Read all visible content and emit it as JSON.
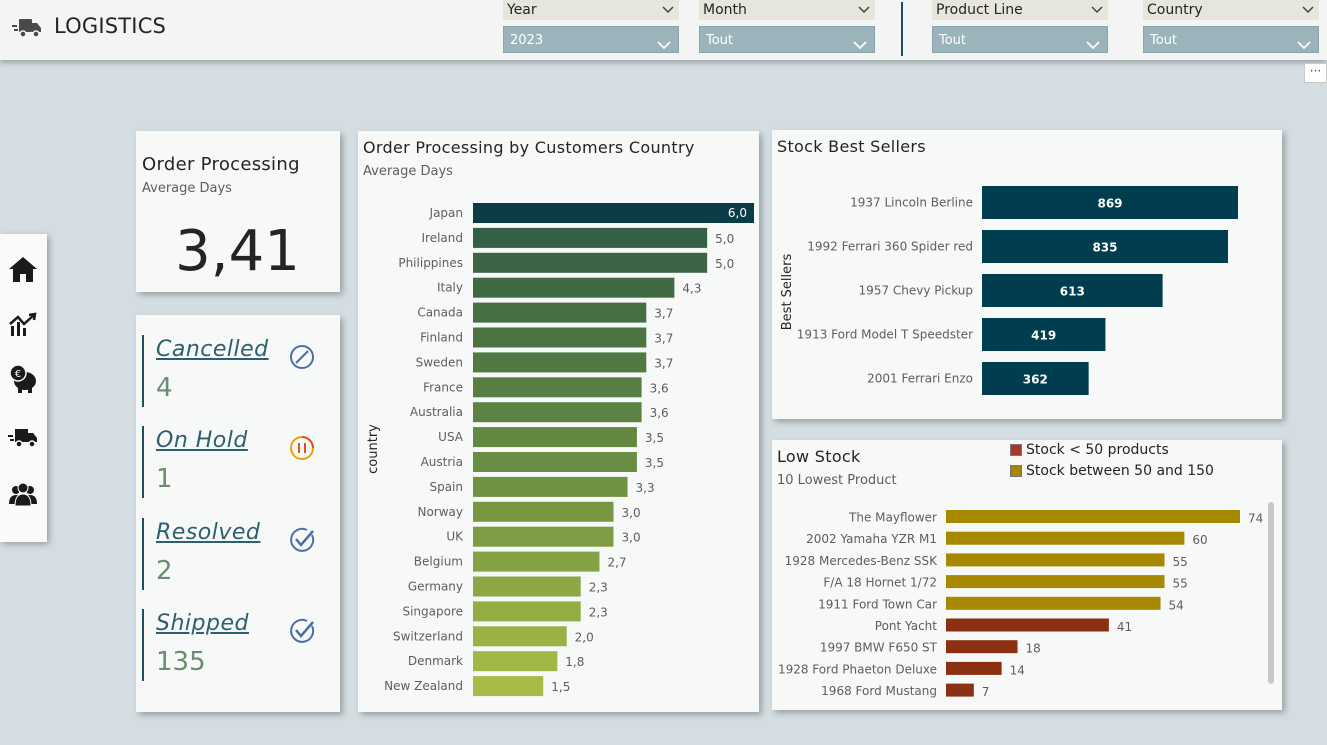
{
  "header": {
    "title": "LOGISTICS",
    "icon": "truck-icon"
  },
  "slicers": [
    {
      "label": "Year",
      "value": "2023"
    },
    {
      "label": "Month",
      "value": "Tout"
    },
    {
      "label": "Product Line",
      "value": "Tout"
    },
    {
      "label": "Country",
      "value": "Tout"
    }
  ],
  "more_button": "···",
  "nav": [
    "home-icon",
    "sales-chart-icon",
    "piggy-bank-icon",
    "truck-icon",
    "customers-icon"
  ],
  "kpi": {
    "title": "Order Processing",
    "subtitle": "Average Days",
    "value": "3,41"
  },
  "statuses": [
    {
      "label": "Cancelled",
      "count": "4",
      "icon": "cancel-icon"
    },
    {
      "label": "On Hold",
      "count": "1",
      "icon": "pause-icon"
    },
    {
      "label": "Resolved",
      "count": "2",
      "icon": "check-icon"
    },
    {
      "label": "Shipped",
      "count": "135",
      "icon": "check-icon"
    }
  ],
  "colors": {
    "dark_teal": "#003e4f",
    "low_stock_red": "#8b3010",
    "mid_stock_gold": "#a68900"
  },
  "chart_data": [
    {
      "type": "bar",
      "orientation": "horizontal",
      "title": "Order Processing by Customers Country",
      "subtitle": "Average Days",
      "ylabel": "country",
      "categories": [
        "Japan",
        "Ireland",
        "Philippines",
        "Italy",
        "Canada",
        "Finland",
        "Sweden",
        "France",
        "Australia",
        "USA",
        "Austria",
        "Spain",
        "Norway",
        "UK",
        "Belgium",
        "Germany",
        "Singapore",
        "Switzerland",
        "Denmark",
        "New Zealand"
      ],
      "values": [
        6.0,
        5.0,
        5.0,
        4.3,
        3.7,
        3.7,
        3.7,
        3.6,
        3.6,
        3.5,
        3.5,
        3.3,
        3.0,
        3.0,
        2.7,
        2.3,
        2.3,
        2.0,
        1.8,
        1.5
      ],
      "value_labels": [
        "6,0",
        "5,0",
        "5,0",
        "4,3",
        "3,7",
        "3,7",
        "3,7",
        "3,6",
        "3,6",
        "3,5",
        "3,5",
        "3,3",
        "3,0",
        "3,0",
        "2,7",
        "2,3",
        "2,3",
        "2,0",
        "1,8",
        "1,5"
      ],
      "xlim": [
        0,
        6
      ]
    },
    {
      "type": "bar",
      "orientation": "horizontal",
      "title": "Stock Best Sellers",
      "ylabel": "Best Sellers",
      "categories": [
        "1937 Lincoln Berline",
        "1992 Ferrari 360 Spider red",
        "1957 Chevy Pickup",
        "1913 Ford Model T Speedster",
        "2001 Ferrari Enzo"
      ],
      "values": [
        869,
        835,
        613,
        419,
        362
      ],
      "value_labels": [
        "869",
        "835",
        "613",
        "419",
        "362"
      ],
      "xlim": [
        0,
        869
      ]
    },
    {
      "type": "bar",
      "orientation": "horizontal",
      "title": "Low Stock",
      "subtitle": "10 Lowest Product",
      "legend": [
        "Stock < 50 products",
        "Stock between 50 and 150"
      ],
      "categories": [
        "The Mayflower",
        "2002 Yamaha YZR M1",
        "1928 Mercedes-Benz SSK",
        "F/A 18 Hornet 1/72",
        "1911 Ford Town Car",
        "Pont Yacht",
        "1997 BMW F650 ST",
        "1928 Ford Phaeton Deluxe",
        "1968 Ford Mustang"
      ],
      "values": [
        74,
        60,
        55,
        55,
        54,
        41,
        18,
        14,
        7
      ],
      "value_labels": [
        "74",
        "60",
        "55",
        "55",
        "54",
        "41",
        "18",
        "14",
        "7"
      ],
      "xlim": [
        0,
        74
      ]
    }
  ]
}
